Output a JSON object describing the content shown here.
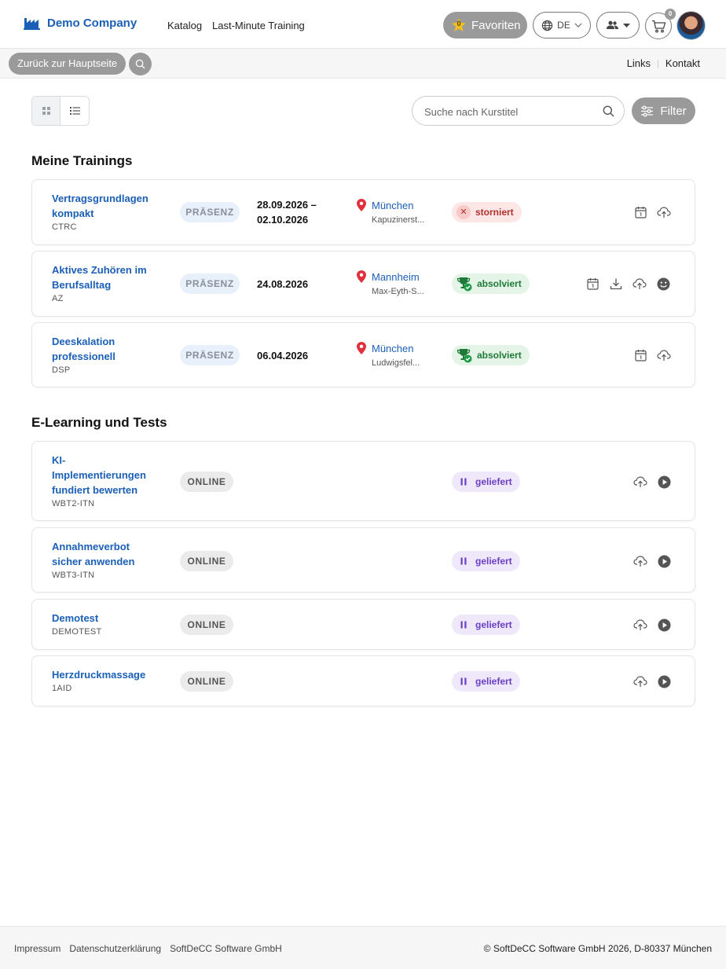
{
  "header": {
    "brand": "Demo Company",
    "nav": [
      "Katalog",
      "Last-Minute Training"
    ],
    "favorites_label": "Favoriten",
    "favorites_count": "0",
    "language": "DE",
    "cart_count": "0"
  },
  "subbar": {
    "back_label": "Zurück zur Hauptseite",
    "links": [
      "Links",
      "Kontakt"
    ]
  },
  "toolbar": {
    "search_placeholder": "Suche nach Kurstitel",
    "filter_label": "Filter"
  },
  "sections": {
    "trainings_title": "Meine Trainings",
    "elearning_title": "E-Learning und Tests"
  },
  "trainings": [
    {
      "title_lines": [
        "Vertragsgrundlagen",
        "kompakt"
      ],
      "code": "CTRC",
      "format": "PRÄSENZ",
      "date_lines": [
        "28.09.2026 –",
        "02.10.2026"
      ],
      "city": "München",
      "street": "Kapuzinerst...",
      "status": "storniert"
    },
    {
      "title_lines": [
        "Aktives Zuhören im",
        "Berufsalltag"
      ],
      "code": "AZ",
      "format": "PRÄSENZ",
      "date_lines": [
        "24.08.2026"
      ],
      "city": "Mannheim",
      "street": "Max-Eyth-S...",
      "status": "absolviert"
    },
    {
      "title_lines": [
        "Deeskalation",
        "professionell"
      ],
      "code": "DSP",
      "format": "PRÄSENZ",
      "date_lines": [
        "06.04.2026"
      ],
      "city": "München",
      "street": "Ludwigsfel...",
      "status": "absolviert"
    }
  ],
  "elearning": [
    {
      "title_lines": [
        "KI-",
        "Implementierungen",
        "fundiert bewerten"
      ],
      "code": "WBT2-ITN",
      "format": "ONLINE",
      "status": "geliefert"
    },
    {
      "title_lines": [
        "Annahmeverbot",
        "sicher anwenden"
      ],
      "code": "WBT3-ITN",
      "format": "ONLINE",
      "status": "geliefert"
    },
    {
      "title_lines": [
        "Demotest"
      ],
      "code": "DEMOTEST",
      "format": "ONLINE",
      "status": "geliefert"
    },
    {
      "title_lines": [
        "Herzdruckmassage"
      ],
      "code": "1AID",
      "format": "ONLINE",
      "status": "geliefert"
    }
  ],
  "footer": {
    "links": [
      "Impressum",
      "Datenschutzerklärung",
      "SoftDeCC Software GmbH"
    ],
    "copyright": "© SoftDeCC Software GmbH 2026, D-80337 München"
  }
}
